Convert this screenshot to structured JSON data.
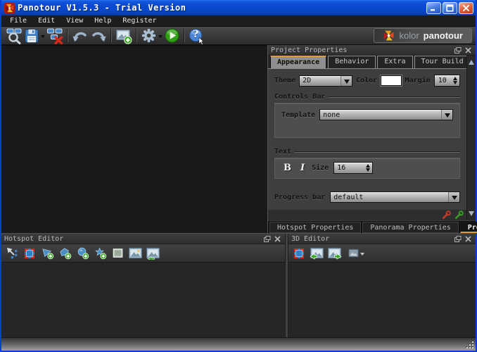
{
  "window": {
    "title": "Panotour V1.5.3 - Trial Version"
  },
  "menu": {
    "items": [
      "File",
      "Edit",
      "View",
      "Help",
      "Register"
    ]
  },
  "toolbar": {
    "brand": {
      "kolor": "kolor",
      "product": "panotour"
    }
  },
  "icons": {
    "help_glyph": "?"
  },
  "properties_panel": {
    "title": "Project Properties",
    "tabs": [
      "Appearance",
      "Behavior",
      "Extra",
      "Tour Build"
    ],
    "active_tab": "Appearance",
    "fields": {
      "theme_label": "Theme",
      "theme_value": "2D",
      "color_label": "Color",
      "margin_label": "Margin",
      "margin_value": "10",
      "controls_bar_group_label": "Controls Bar",
      "template_label": "Template",
      "template_value": "none",
      "text_group_label": "Text",
      "bold_button_label": "B",
      "italic_button_label": "I",
      "size_label": "Size",
      "size_value": "16",
      "progress_bar_label": "Progress bar",
      "progress_bar_value": "default"
    },
    "bottom_tabs": [
      "Hotspot Properties",
      "Panorama Properties",
      "Project Properties"
    ],
    "active_bottom_tab": "Project Properties"
  },
  "hotspot_editor": {
    "title": "Hotspot Editor"
  },
  "editor_3d": {
    "title": "3D Editor"
  },
  "colors": {
    "titlebar_blue": "#0b4bd2",
    "accent_orange": "#e39a3b",
    "close_red": "#d03818",
    "hotspot_blue": "#4a8fc4",
    "action_green": "#35a81e"
  }
}
